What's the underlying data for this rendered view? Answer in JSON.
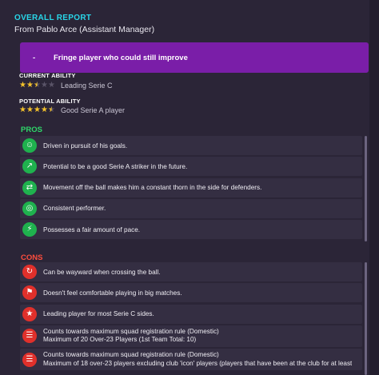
{
  "report": {
    "title": "OVERALL REPORT",
    "from": "From Pablo Arce (Assistant Manager)"
  },
  "summary": {
    "dash": "-",
    "text": "Fringe player who could still improve"
  },
  "current_ability": {
    "label": "CURRENT ABILITY",
    "stars": 2.5,
    "max_stars": 5,
    "text": "Leading Serie C"
  },
  "potential_ability": {
    "label": "POTENTIAL ABILITY",
    "stars": 4.5,
    "max_stars": 5,
    "text": "Good Serie A player"
  },
  "pros": {
    "title": "PROS",
    "items": [
      {
        "icon": "head-brain-icon",
        "text": "Driven in pursuit of his goals."
      },
      {
        "icon": "trend-up-icon",
        "text": "Potential to be a good Serie A striker in the future."
      },
      {
        "icon": "player-movement-icon",
        "text": "Movement off the ball makes him a constant thorn in the side for defenders."
      },
      {
        "icon": "target-icon",
        "text": "Consistent performer."
      },
      {
        "icon": "lightning-icon",
        "text": "Possesses a fair amount of pace."
      }
    ]
  },
  "cons": {
    "title": "CONS",
    "items": [
      {
        "icon": "crossing-icon",
        "text": "Can be wayward when crossing the ball."
      },
      {
        "icon": "big-match-icon",
        "text": "Doesn't feel comfortable playing in big matches."
      },
      {
        "icon": "star-icon",
        "text": "Leading player for most Serie C sides."
      },
      {
        "icon": "registration-icon",
        "text": "Counts towards maximum squad registration rule (Domestic)",
        "text2": "Maximum of 20 Over-23 Players (1st Team Total: 10)"
      },
      {
        "icon": "registration-icon",
        "text": "Counts towards maximum squad registration rule (Domestic)",
        "text2": "Maximum of 18 over-23 players excluding club 'icon' players (players that have been at the club for at least"
      }
    ]
  },
  "colors": {
    "background": "#2b2537",
    "accent_title": "#28d6e8",
    "summary_bg": "#7a1ea8",
    "pros": "#2fd86a",
    "cons": "#ff4d3d",
    "star": "#f4c22b"
  }
}
